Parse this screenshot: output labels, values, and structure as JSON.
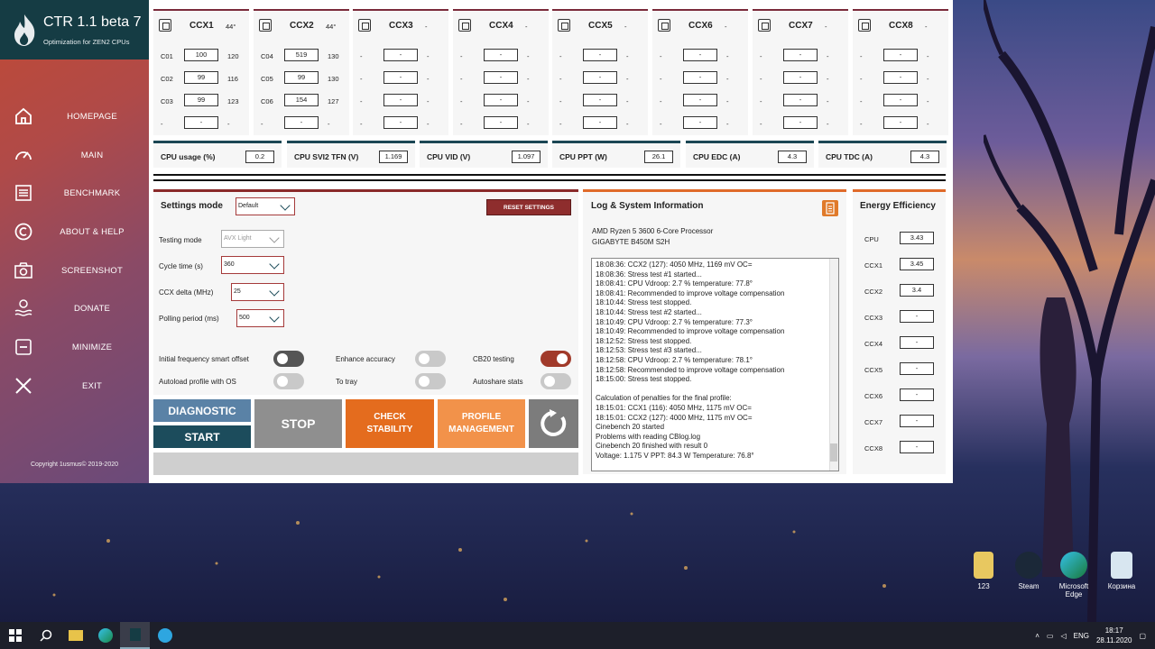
{
  "app": {
    "title": "CTR 1.1 beta 7",
    "subtitle": "Optimization for ZEN2 CPUs",
    "copyright": "Copyright 1usmus© 2019-2020"
  },
  "sidebar": {
    "items": [
      {
        "label": "HOMEPAGE",
        "icon": "home-icon"
      },
      {
        "label": "MAIN",
        "icon": "speedometer-icon"
      },
      {
        "label": "BENCHMARK",
        "icon": "list-icon"
      },
      {
        "label": "ABOUT & HELP",
        "icon": "copyright-icon"
      },
      {
        "label": "SCREENSHOT",
        "icon": "camera-icon"
      },
      {
        "label": "DONATE",
        "icon": "donate-icon"
      },
      {
        "label": "MINIMIZE",
        "icon": "minimize-icon"
      },
      {
        "label": "EXIT",
        "icon": "close-icon"
      }
    ]
  },
  "ccx": [
    {
      "name": "CCX1",
      "temp": "44°",
      "rows": [
        {
          "core": "C01",
          "value": "100",
          "max": "120"
        },
        {
          "core": "C02",
          "value": "99",
          "max": "116"
        },
        {
          "core": "C03",
          "value": "99",
          "max": "123"
        },
        {
          "core": "-",
          "value": "-",
          "max": "-"
        }
      ]
    },
    {
      "name": "CCX2",
      "temp": "44°",
      "rows": [
        {
          "core": "C04",
          "value": "519",
          "max": "130"
        },
        {
          "core": "C05",
          "value": "99",
          "max": "130"
        },
        {
          "core": "C06",
          "value": "154",
          "max": "127"
        },
        {
          "core": "-",
          "value": "-",
          "max": "-"
        }
      ]
    },
    {
      "name": "CCX3",
      "temp": "-",
      "rows": [
        {
          "core": "-",
          "value": "-",
          "max": "-"
        },
        {
          "core": "-",
          "value": "-",
          "max": "-"
        },
        {
          "core": "-",
          "value": "-",
          "max": "-"
        },
        {
          "core": "-",
          "value": "-",
          "max": "-"
        }
      ]
    },
    {
      "name": "CCX4",
      "temp": "-",
      "rows": [
        {
          "core": "-",
          "value": "-",
          "max": "-"
        },
        {
          "core": "-",
          "value": "-",
          "max": "-"
        },
        {
          "core": "-",
          "value": "-",
          "max": "-"
        },
        {
          "core": "-",
          "value": "-",
          "max": "-"
        }
      ]
    },
    {
      "name": "CCX5",
      "temp": "-",
      "rows": [
        {
          "core": "-",
          "value": "-",
          "max": "-"
        },
        {
          "core": "-",
          "value": "-",
          "max": "-"
        },
        {
          "core": "-",
          "value": "-",
          "max": "-"
        },
        {
          "core": "-",
          "value": "-",
          "max": "-"
        }
      ]
    },
    {
      "name": "CCX6",
      "temp": "-",
      "rows": [
        {
          "core": "-",
          "value": "-",
          "max": "-"
        },
        {
          "core": "-",
          "value": "-",
          "max": "-"
        },
        {
          "core": "-",
          "value": "-",
          "max": "-"
        },
        {
          "core": "-",
          "value": "-",
          "max": "-"
        }
      ]
    },
    {
      "name": "CCX7",
      "temp": "-",
      "rows": [
        {
          "core": "-",
          "value": "-",
          "max": "-"
        },
        {
          "core": "-",
          "value": "-",
          "max": "-"
        },
        {
          "core": "-",
          "value": "-",
          "max": "-"
        },
        {
          "core": "-",
          "value": "-",
          "max": "-"
        }
      ]
    },
    {
      "name": "CCX8",
      "temp": "-",
      "rows": [
        {
          "core": "-",
          "value": "-",
          "max": "-"
        },
        {
          "core": "-",
          "value": "-",
          "max": "-"
        },
        {
          "core": "-",
          "value": "-",
          "max": "-"
        },
        {
          "core": "-",
          "value": "-",
          "max": "-"
        }
      ]
    }
  ],
  "stats": [
    {
      "label": "CPU usage (%)",
      "value": "0.2"
    },
    {
      "label": "CPU SVI2 TFN (V)",
      "value": "1.169"
    },
    {
      "label": "CPU VID (V)",
      "value": "1.097"
    },
    {
      "label": "CPU PPT (W)",
      "value": "26.1"
    },
    {
      "label": "CPU EDC (A)",
      "value": "4.3"
    },
    {
      "label": "CPU TDC (A)",
      "value": "4.3"
    }
  ],
  "settings": {
    "title": "Settings mode",
    "mode_value": "Default",
    "reset_label": "RESET SETTINGS",
    "testing_mode_label": "Testing mode",
    "testing_mode_value": "AVX Light",
    "cycle_time_label": "Cycle time (s)",
    "cycle_time_value": "360",
    "ccx_delta_label": "CCX delta (MHz)",
    "ccx_delta_value": "25",
    "polling_label": "Polling period (ms)",
    "polling_value": "500",
    "toggles": [
      {
        "label": "Initial frequency smart offset",
        "state": "dark"
      },
      {
        "label": "Enhance accuracy",
        "state": "off"
      },
      {
        "label": "CB20 testing",
        "state": "on"
      },
      {
        "label": "Autoload profile with OS",
        "state": "off"
      },
      {
        "label": "To tray",
        "state": "off"
      },
      {
        "label": "Autoshare stats",
        "state": "off"
      }
    ]
  },
  "actions": {
    "diagnostic": "DIAGNOSTIC",
    "start": "START",
    "stop": "STOP",
    "check_stability": "CHECK STABILITY",
    "profile_management": "PROFILE MANAGEMENT",
    "refresh_icon": "refresh-icon"
  },
  "log": {
    "title": "Log & System Information",
    "cpu": "AMD Ryzen 5 3600 6-Core Processor",
    "board": "GIGABYTE B450M S2H",
    "lines": [
      "18:08:36: CCX2 (127): 4050 MHz, 1169 mV  OC=",
      "18:08:36: Stress test #1 started...",
      "18:08:41: CPU Vdroop: 2.7 % temperature: 77.8°",
      "18:08:41: Recommended to improve voltage compensation",
      "18:10:44: Stress test stopped.",
      "18:10:44: Stress test #2 started...",
      "18:10:49: CPU Vdroop: 2.7 % temperature: 77.3°",
      "18:10:49: Recommended to improve voltage compensation",
      "18:12:52: Stress test stopped.",
      "18:12:53: Stress test #3 started...",
      "18:12:58: CPU Vdroop: 2.7 % temperature: 78.1°",
      "18:12:58: Recommended to improve voltage compensation",
      "18:15:00: Stress test stopped.",
      "",
      "Calculation of penalties for the final profile:",
      "18:15:01: CCX1 (116): 4050 MHz, 1175 mV  OC=",
      "18:15:01: CCX2 (127): 4000 MHz, 1175 mV  OC=",
      "Cinebench 20 started",
      "Problems with reading CBlog.log",
      "Cinebench 20 finished with result 0",
      "Voltage: 1.175 V  PPT: 84.3 W  Temperature: 76.8°"
    ]
  },
  "energy": {
    "title": "Energy Efficiency",
    "rows": [
      {
        "label": "CPU",
        "value": "3.43"
      },
      {
        "label": "CCX1",
        "value": "3.45"
      },
      {
        "label": "CCX2",
        "value": "3.4"
      },
      {
        "label": "CCX3",
        "value": "-"
      },
      {
        "label": "CCX4",
        "value": "-"
      },
      {
        "label": "CCX5",
        "value": "-"
      },
      {
        "label": "CCX6",
        "value": "-"
      },
      {
        "label": "CCX7",
        "value": "-"
      },
      {
        "label": "CCX8",
        "value": "-"
      }
    ]
  },
  "desktop": {
    "icons": [
      {
        "label": "123",
        "icon": "folder-icon"
      },
      {
        "label": "Steam",
        "icon": "steam-icon"
      },
      {
        "label": "Microsoft Edge",
        "icon": "edge-icon"
      },
      {
        "label": "Корзина",
        "icon": "recycle-bin-icon"
      }
    ]
  },
  "taskbar": {
    "language": "ENG",
    "time": "18:17",
    "date": "28.11.2020"
  }
}
